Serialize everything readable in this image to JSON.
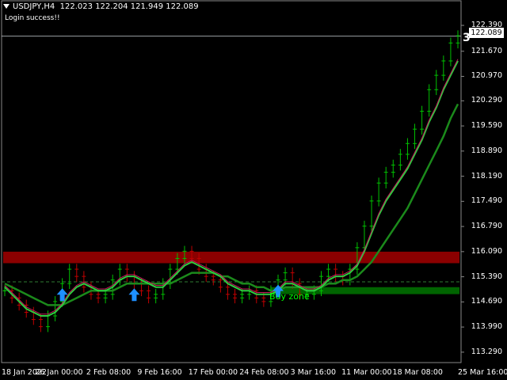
{
  "header": {
    "symbol_tf": "USDJPY,H4",
    "ohlc": "122.023 122.204 121.949 122.089"
  },
  "message": "Login success!!",
  "current_price_label": "122.089",
  "marker_number": "3",
  "zone_label": "Buy zone",
  "colors": {
    "background": "#000000",
    "bull": "#00c000",
    "bear": "#c00000",
    "resistance_zone": "#8b0000",
    "support_zone": "#006400",
    "ma_fast": "#22aa22",
    "ma_slow": "#22aa22",
    "arrow": "#1e90ff"
  },
  "chart_data": {
    "type": "line",
    "y_ticks": [
      "122.390",
      "121.670",
      "120.970",
      "120.290",
      "119.590",
      "118.890",
      "118.190",
      "117.490",
      "116.790",
      "116.090",
      "115.390",
      "114.690",
      "113.990",
      "113.290"
    ],
    "x_ticks": [
      "18 Jan 2022",
      "26 Jan 00:00",
      "2 Feb 08:00",
      "9 Feb 16:00",
      "17 Feb 00:00",
      "24 Feb 08:00",
      "3 Mar 16:00",
      "11 Mar 00:00",
      "18 Mar 08:00",
      "25 Mar 16:00"
    ],
    "ylim": [
      113.0,
      122.7
    ],
    "current_price": 122.089,
    "resistance_zone": [
      115.9,
      116.0
    ],
    "support_zone": [
      114.95,
      115.1
    ],
    "close_series": [
      115.0,
      114.8,
      114.6,
      114.4,
      114.2,
      114.0,
      114.3,
      114.7,
      115.2,
      115.6,
      115.4,
      115.1,
      114.9,
      114.8,
      114.9,
      115.3,
      115.6,
      115.4,
      115.2,
      115.0,
      114.8,
      114.9,
      115.2,
      115.6,
      115.9,
      116.1,
      115.9,
      115.6,
      115.4,
      115.3,
      115.1,
      114.9,
      114.8,
      114.9,
      115.0,
      114.8,
      114.7,
      115.0,
      115.3,
      115.5,
      115.2,
      114.9,
      114.9,
      115.0,
      115.4,
      115.6,
      115.4,
      115.3,
      115.6,
      116.2,
      116.8,
      117.5,
      118.0,
      118.3,
      118.5,
      118.8,
      119.1,
      119.5,
      120.0,
      120.6,
      121.0,
      121.4,
      121.9,
      122.1
    ],
    "ma_fast_series": [
      115.1,
      114.9,
      114.7,
      114.5,
      114.4,
      114.3,
      114.3,
      114.4,
      114.6,
      114.9,
      115.1,
      115.2,
      115.1,
      115.0,
      115.0,
      115.1,
      115.3,
      115.4,
      115.4,
      115.3,
      115.2,
      115.1,
      115.1,
      115.3,
      115.5,
      115.7,
      115.8,
      115.7,
      115.6,
      115.5,
      115.4,
      115.2,
      115.1,
      115.0,
      115.0,
      114.9,
      114.9,
      114.9,
      115.0,
      115.2,
      115.2,
      115.1,
      115.0,
      115.0,
      115.1,
      115.3,
      115.4,
      115.4,
      115.5,
      115.7,
      116.1,
      116.6,
      117.1,
      117.5,
      117.8,
      118.1,
      118.4,
      118.8,
      119.2,
      119.7,
      120.1,
      120.6,
      121.0,
      121.4
    ],
    "ma_slow_series": [
      115.2,
      115.1,
      115.0,
      114.9,
      114.8,
      114.7,
      114.6,
      114.6,
      114.6,
      114.7,
      114.8,
      114.9,
      115.0,
      115.0,
      115.0,
      115.0,
      115.1,
      115.2,
      115.2,
      115.2,
      115.2,
      115.2,
      115.2,
      115.2,
      115.3,
      115.4,
      115.5,
      115.5,
      115.5,
      115.5,
      115.4,
      115.4,
      115.3,
      115.2,
      115.2,
      115.1,
      115.1,
      115.0,
      115.0,
      115.1,
      115.1,
      115.1,
      115.1,
      115.1,
      115.1,
      115.2,
      115.2,
      115.3,
      115.3,
      115.4,
      115.6,
      115.8,
      116.1,
      116.4,
      116.7,
      117.0,
      117.3,
      117.7,
      118.1,
      118.5,
      118.9,
      119.3,
      119.8,
      120.2
    ],
    "up_arrows_at_index": [
      8,
      18,
      38
    ]
  }
}
